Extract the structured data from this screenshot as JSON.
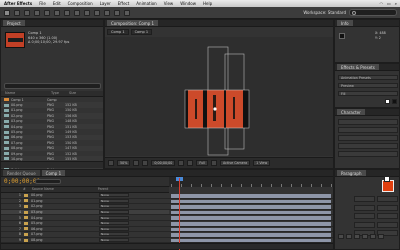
{
  "menubar": {
    "app": "After Effects",
    "items": [
      "File",
      "Edit",
      "Composition",
      "Layer",
      "Effect",
      "Animation",
      "View",
      "Window",
      "Help"
    ]
  },
  "toolbar": {
    "workspace_label": "Workspace: Standard"
  },
  "project": {
    "tab": "Project",
    "comp_name": "Comp 1",
    "info_lines": [
      "640 x 360 (1.00)",
      "Δ 0;00;10;00, 29.97 fps"
    ],
    "columns": [
      "Name",
      "Type",
      "Size"
    ],
    "items": [
      {
        "name": "Comp 1",
        "type": "Comp",
        "size": "",
        "icon": "comp-icon"
      },
      {
        "name": "00.png",
        "type": "PNG",
        "size": "152 KB",
        "icon": "image-icon"
      },
      {
        "name": "01.png",
        "type": "PNG",
        "size": "150 KB",
        "icon": "image-icon"
      },
      {
        "name": "02.png",
        "type": "PNG",
        "size": "156 KB",
        "icon": "image-icon"
      },
      {
        "name": "03.png",
        "type": "PNG",
        "size": "148 KB",
        "icon": "image-icon"
      },
      {
        "name": "04.png",
        "type": "PNG",
        "size": "151 KB",
        "icon": "image-icon"
      },
      {
        "name": "05.png",
        "type": "PNG",
        "size": "149 KB",
        "icon": "image-icon"
      },
      {
        "name": "06.png",
        "type": "PNG",
        "size": "153 KB",
        "icon": "image-icon"
      },
      {
        "name": "07.png",
        "type": "PNG",
        "size": "150 KB",
        "icon": "image-icon"
      },
      {
        "name": "08.png",
        "type": "PNG",
        "size": "147 KB",
        "icon": "image-icon"
      },
      {
        "name": "09.png",
        "type": "PNG",
        "size": "152 KB",
        "icon": "image-icon"
      },
      {
        "name": "10.png",
        "type": "PNG",
        "size": "155 KB",
        "icon": "image-icon"
      },
      {
        "name": "11.png",
        "type": "PNG",
        "size": "149 KB",
        "icon": "image-icon"
      },
      {
        "name": "Solids",
        "type": "Folder",
        "size": "",
        "icon": "folder-icon"
      }
    ]
  },
  "viewer": {
    "tab": "Composition: Comp 1",
    "crumbs": [
      "Comp 1",
      "Comp 1"
    ],
    "footer": [
      "50%",
      "0;00;00;00",
      "Full",
      "Active Camera",
      "1 View"
    ]
  },
  "info": {
    "tab": "Info",
    "lines": [
      "X: 488",
      "Y: 2"
    ]
  },
  "effects": {
    "tab": "Effects & Presets",
    "rows": [
      "Animation Presets",
      "Preview",
      "Fill"
    ]
  },
  "character": {
    "tab": "Character"
  },
  "timeline": {
    "tabs": [
      "Render Queue",
      "Comp 1"
    ],
    "timecode": "0;00;00;00",
    "columns": [
      "#",
      "Source Name",
      "Parent"
    ],
    "layers": [
      {
        "num": "1",
        "name": "00.png",
        "parent": "None",
        "color": "#c9a24e"
      },
      {
        "num": "2",
        "name": "01.png",
        "parent": "None",
        "color": "#c9a24e"
      },
      {
        "num": "3",
        "name": "02.png",
        "parent": "None",
        "color": "#c9a24e"
      },
      {
        "num": "4",
        "name": "03.png",
        "parent": "None",
        "color": "#c9a24e"
      },
      {
        "num": "5",
        "name": "04.png",
        "parent": "None",
        "color": "#c9a24e"
      },
      {
        "num": "6",
        "name": "05.png",
        "parent": "None",
        "color": "#c9a24e"
      },
      {
        "num": "7",
        "name": "06.png",
        "parent": "None",
        "color": "#c9a24e"
      },
      {
        "num": "8",
        "name": "07.png",
        "parent": "None",
        "color": "#c9a24e"
      },
      {
        "num": "9",
        "name": "08.png",
        "parent": "None",
        "color": "#c9a24e"
      }
    ]
  },
  "paragraph": {
    "tab": "Paragraph"
  },
  "colors": {
    "accent_orange": "#e0a030",
    "playhead": "#d93b2b",
    "layer_bar": "#8e96a8",
    "strip_red": "#cc4a2a"
  }
}
